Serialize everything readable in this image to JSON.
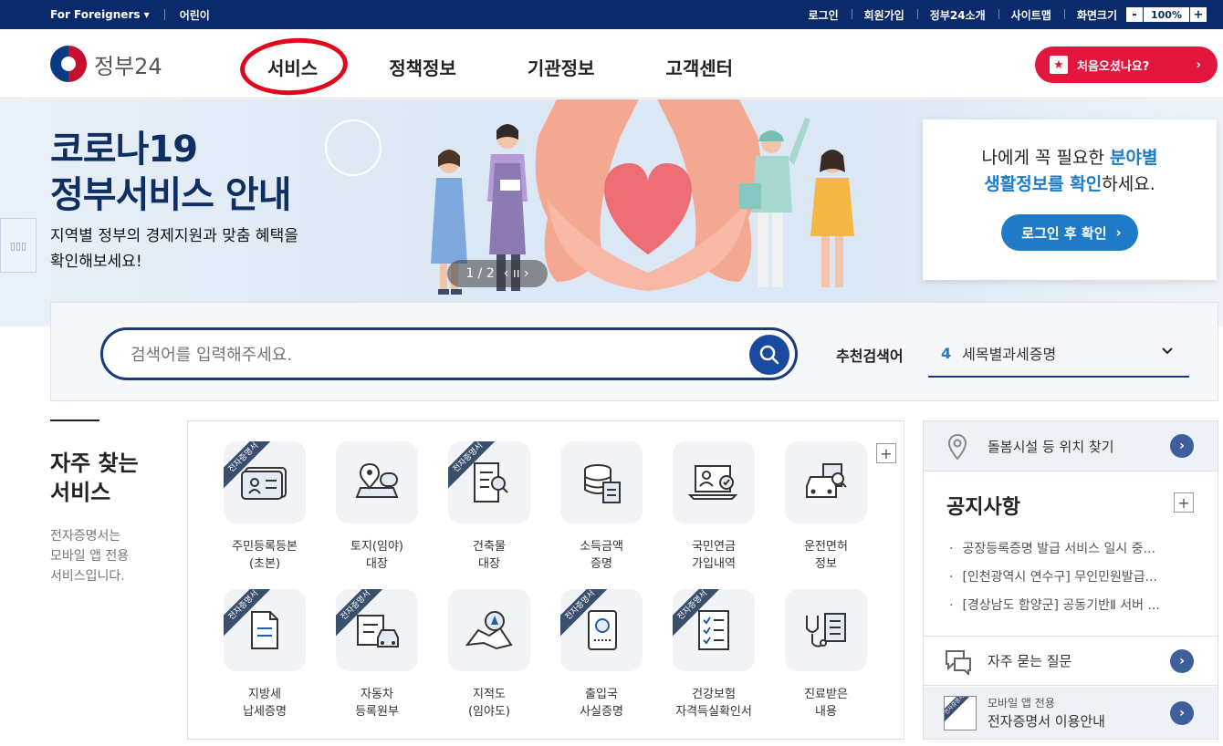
{
  "topbar": {
    "foreigners": "For Foreigners ▾",
    "kids": "어린이",
    "links": [
      "로그인",
      "회원가입",
      "정부24소개",
      "사이트맵",
      "화면크기"
    ],
    "zoom_minus": "-",
    "zoom_value": "100%",
    "zoom_plus": "+"
  },
  "header": {
    "logo_text": "정부24",
    "nav": [
      "서비스",
      "정책정보",
      "기관정보",
      "고객센터"
    ],
    "first_visit": "처음오셨나요?",
    "first_visit_arrow": "›"
  },
  "hero": {
    "title_line1": "코로나19",
    "title_line2": "정부서비스 안내",
    "sub_line1": "지역별 정부의 경제지원과 맞춤 혜택을",
    "sub_line2": "확인해보세요!",
    "pager": "1 / 2",
    "pager_controls": "‹ ıı ›"
  },
  "login_card": {
    "line1_plain": "나에게 꼭 필요한 ",
    "line1_hl": "분야별",
    "line2_hl": "생활정보를 확인",
    "line2_plain": "하세요.",
    "button": "로그인 후 확인",
    "button_arrow": "›"
  },
  "search": {
    "placeholder": "검색어를 입력해주세요.",
    "recommend_label": "추천검색어",
    "recommend_num": "4",
    "recommend_value": "세목별과세증명"
  },
  "frequent": {
    "title_line1": "자주 찾는",
    "title_line2": "서비스",
    "desc_line1": "전자증명서는",
    "desc_line2": "모바일 앱 전용",
    "desc_line3": "서비스입니다.",
    "plus": "+",
    "ribbon": "전자증명서",
    "services": [
      {
        "l1": "주민등록등본",
        "l2": "(초본)"
      },
      {
        "l1": "토지(임야)",
        "l2": "대장"
      },
      {
        "l1": "건축물",
        "l2": "대장"
      },
      {
        "l1": "소득금액",
        "l2": "증명"
      },
      {
        "l1": "국민연금",
        "l2": "가입내역"
      },
      {
        "l1": "운전면허",
        "l2": "정보"
      },
      {
        "l1": "지방세",
        "l2": "납세증명"
      },
      {
        "l1": "자동차",
        "l2": "등록원부"
      },
      {
        "l1": "지적도",
        "l2": "(임야도)"
      },
      {
        "l1": "출입국",
        "l2": "사실증명"
      },
      {
        "l1": "건강보험",
        "l2": "자격득실확인서"
      },
      {
        "l1": "진료받은",
        "l2": "내용"
      }
    ]
  },
  "right": {
    "care_finder": "돌봄시설 등 위치 찾기",
    "notice_title": "공지사항",
    "notice_plus": "+",
    "notices": [
      "공장등록증명 발급 서비스 일시 중...",
      "[인천광역시 연수구] 무인민원발급...",
      "[경상남도 함양군] 공동기반Ⅱ 서버 ..."
    ],
    "faq": "자주 묻는 질문",
    "mobile_small": "모바일 앱 전용",
    "mobile_main": "전자증명서 이용안내",
    "go": "›"
  },
  "colors": {
    "topbar": "#0b2a6b",
    "accent_red": "#e3173e",
    "accent_blue": "#1f7ac7",
    "hero_title": "#0f2f63"
  }
}
